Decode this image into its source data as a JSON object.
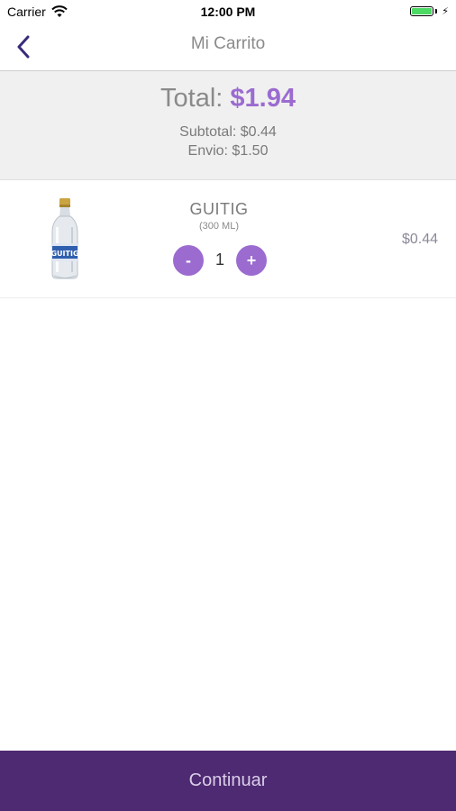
{
  "status_bar": {
    "carrier": "Carrier",
    "time": "12:00 PM",
    "battery_level": 1.0,
    "battery_color": "#4cd964"
  },
  "nav": {
    "back_icon": "chevron-left-icon",
    "title": "Mi Carrito"
  },
  "summary": {
    "total_label": "Total:",
    "total_value": "$1.94",
    "subtotal": "Subtotal: $0.44",
    "shipping": "Envio: $1.50"
  },
  "cart": {
    "items": [
      {
        "name": "GUITIG",
        "size": "(300 ML)",
        "brand_text": "GUITIG",
        "quantity": "1",
        "minus_label": "-",
        "plus_label": "+",
        "price": "$0.44"
      }
    ]
  },
  "footer": {
    "continue_label": "Continuar"
  },
  "colors": {
    "accent": "#9b6bd0",
    "footer_bg": "#4e2a72",
    "back_arrow": "#3b2a7a"
  }
}
